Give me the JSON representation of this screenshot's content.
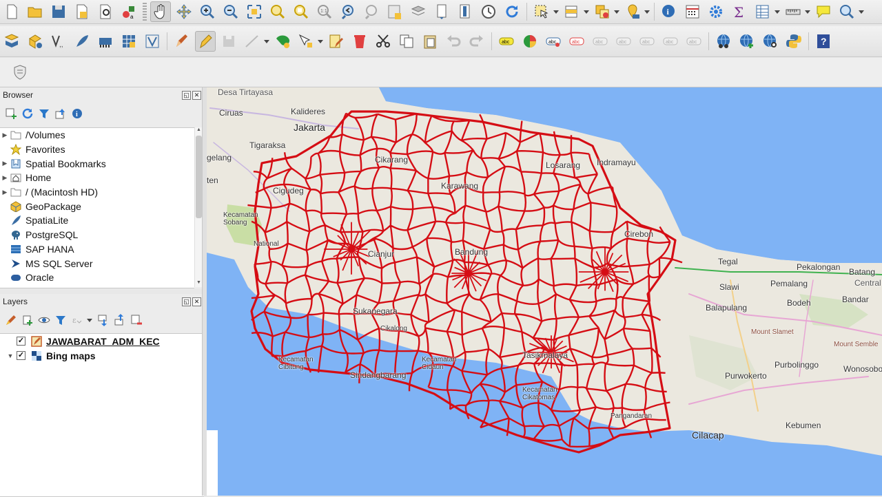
{
  "browser": {
    "title": "Browser",
    "items": [
      {
        "label": "/Volumes",
        "icon": "folder-icon",
        "expandable": true
      },
      {
        "label": "Favorites",
        "icon": "star-icon",
        "expandable": false
      },
      {
        "label": "Spatial Bookmarks",
        "icon": "bookmark-icon",
        "expandable": true
      },
      {
        "label": "Home",
        "icon": "home-icon",
        "expandable": true
      },
      {
        "label": "/ (Macintosh HD)",
        "icon": "folder-icon",
        "expandable": true
      },
      {
        "label": "GeoPackage",
        "icon": "geopackage-icon",
        "expandable": false
      },
      {
        "label": "SpatiaLite",
        "icon": "feather-icon",
        "expandable": false
      },
      {
        "label": "PostgreSQL",
        "icon": "elephant-icon",
        "expandable": false
      },
      {
        "label": "SAP HANA",
        "icon": "database-icon",
        "expandable": false
      },
      {
        "label": "MS SQL Server",
        "icon": "mssql-icon",
        "expandable": false
      },
      {
        "label": "Oracle",
        "icon": "oracle-icon",
        "expandable": false
      }
    ]
  },
  "layers": {
    "title": "Layers",
    "items": [
      {
        "label": "JAWABARAT_ADM_KEC",
        "checked": true,
        "icon": "polygon-layer-icon",
        "editing": true
      },
      {
        "label": "Bing maps",
        "checked": true,
        "icon": "raster-layer-icon",
        "group": true
      }
    ]
  },
  "map": {
    "colors": {
      "sea": "#7fb3f5",
      "land": "#ebe8df",
      "boundary": "#d50d14",
      "road": "#c8b7e0"
    },
    "labels": [
      "Desa Tirtayasa",
      "Ciruas",
      "Kalideres",
      "Jakarta",
      "Tigaraksa",
      "gelang",
      "ten",
      "Cigudeg",
      "Kecamatan Sobang",
      "National",
      "Cianjur",
      "Sukanegara",
      "Cikalong",
      "Kecamatan Cibitung",
      "Sindangbarang",
      "Kecamatan Cidaun",
      "Cikarang",
      "Karawang",
      "Losarang",
      "Indramayu",
      "Cirebon",
      "Bandung",
      "Tasikmalaya",
      "Kecamatan Cikatomas",
      "Pangandaran",
      "Tegal",
      "Pekalongan",
      "Batang",
      "Central",
      "Slawi",
      "Pemalang",
      "Balapulang",
      "Bodeh",
      "Bandar",
      "Mount Slamet",
      "Mount Semble",
      "Purbolinggo",
      "Purwokerto",
      "Wonosobo",
      "Cilacap",
      "Kebumen"
    ]
  }
}
